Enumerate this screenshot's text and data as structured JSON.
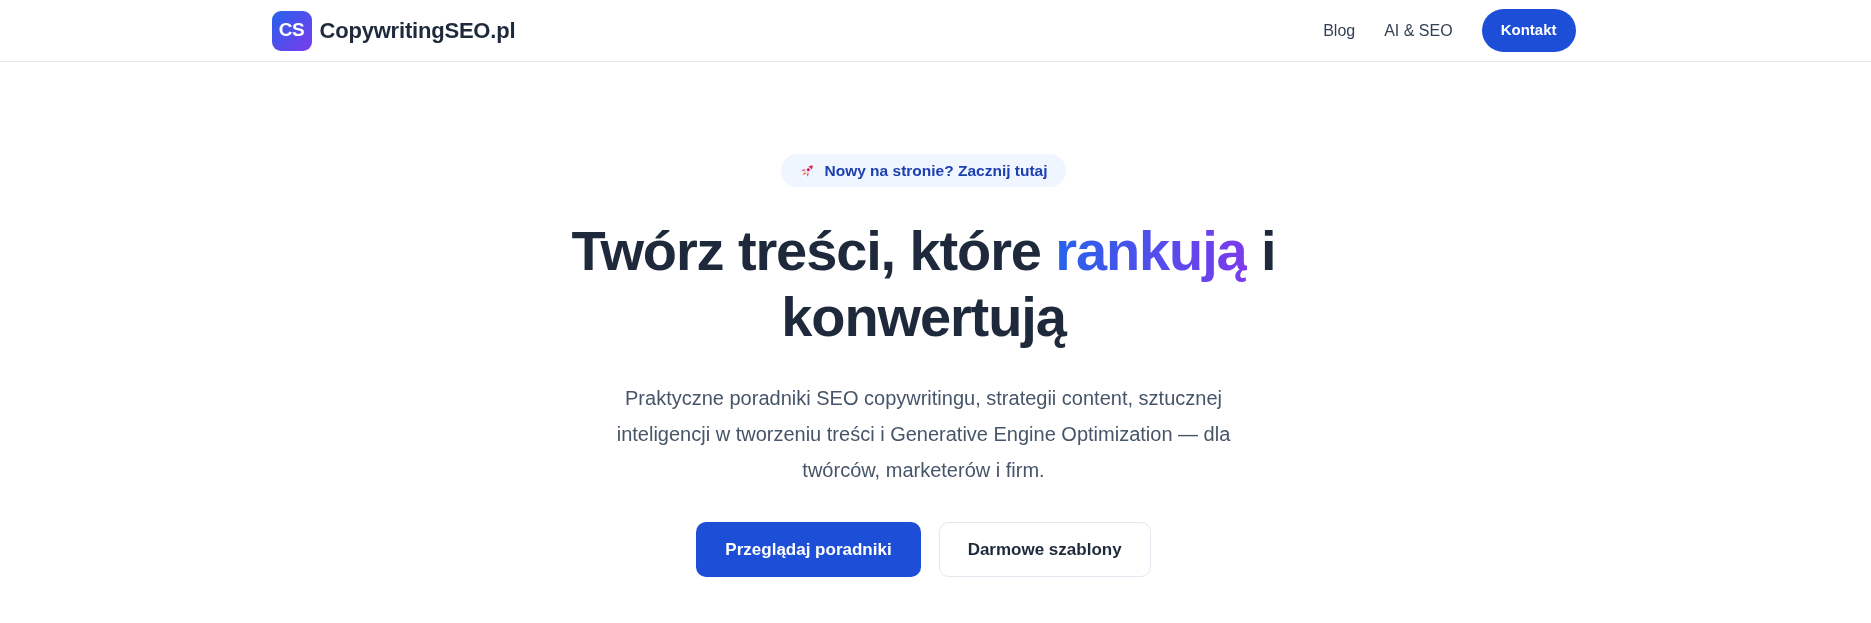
{
  "header": {
    "logo": {
      "initials": "CS",
      "name": "CopywritingSEO.pl"
    },
    "nav": [
      {
        "label": "Blog",
        "kind": "link"
      },
      {
        "label": "AI & SEO",
        "kind": "link"
      },
      {
        "label": "Kontakt",
        "kind": "button"
      }
    ]
  },
  "hero": {
    "badge": {
      "text": "Nowy na stronie? Zacznij tutaj"
    },
    "heading": {
      "before": "Twórz treści, które ",
      "highlight": "rankują",
      "after": " i konwertują"
    },
    "description": "Praktyczne poradniki SEO copywritingu, strategii content, sztucznej inteligencji w tworzeniu treści i Generative Engine Optimization — dla twórców, marketerów i firm.",
    "buttons": [
      {
        "label": "Przeglądaj poradniki",
        "kind": "primary"
      },
      {
        "label": "Darmowe szablony",
        "kind": "secondary"
      }
    ]
  }
}
